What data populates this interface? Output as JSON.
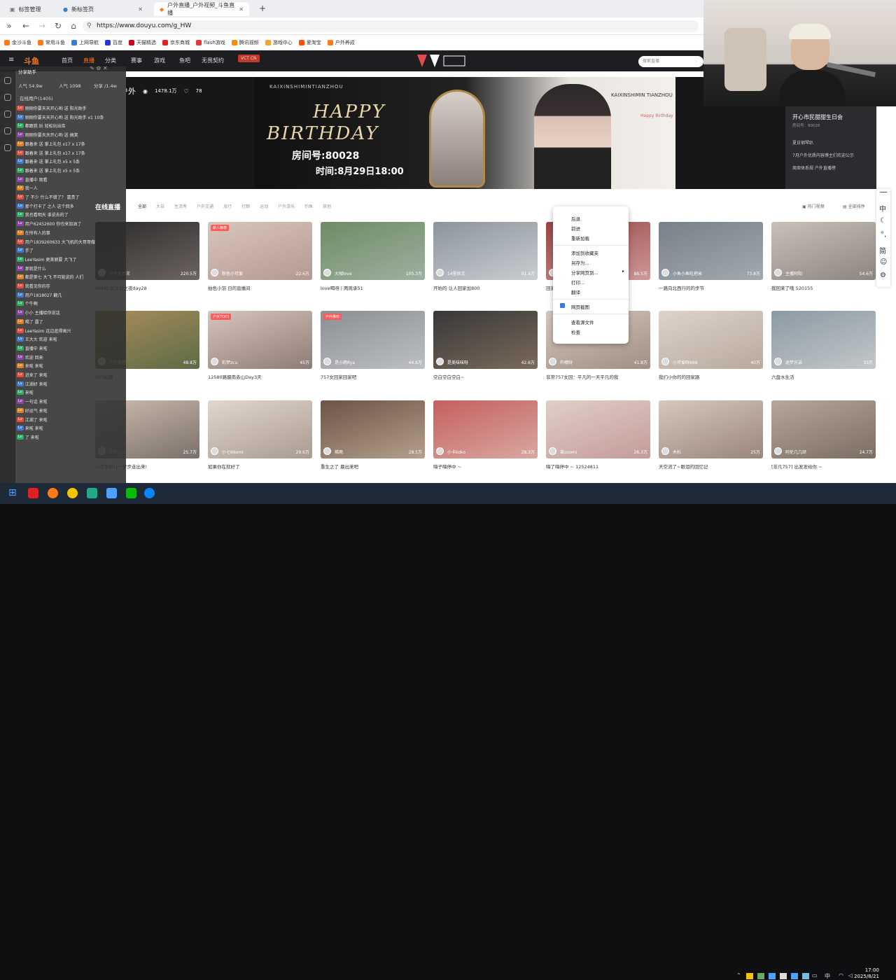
{
  "browser": {
    "tabs": [
      {
        "label": "标签管理"
      },
      {
        "label": "新标签页"
      },
      {
        "label": "户外直播_户外视频_斗鱼直播"
      }
    ],
    "url": "https://www.douyu.com/g_HW",
    "bookmarks": [
      "金沙斗鱼",
      "常用斗鱼",
      "上网导航",
      "百度",
      "天猫精选",
      "京东商城",
      "flash游戏",
      "腾讯视频",
      "游戏中心",
      "爱淘宝",
      "户外养成"
    ]
  },
  "site": {
    "logo": "斗鱼",
    "nav": [
      "首页",
      "直播",
      "分类",
      "赛事",
      "游戏",
      "鱼吧",
      "无畏契约"
    ],
    "vct_label": "VCT CN",
    "search_placeholder": "搜索直播"
  },
  "category": {
    "title": "户外",
    "views": "1478.1万",
    "followers": "78"
  },
  "left_panel": {
    "header": [
      "分享助手",
      "人气 54.9w",
      "人气 1098",
      "分享 /1.4w"
    ],
    "online_count": "在线用户(1405)",
    "live_now": "在线直播",
    "comments": [
      "刚刚你要天天开心哟 送 阳光助手",
      "刚刚你要天天开心哟 送 阳光助手 x1 10条",
      "都跟我 玩 轻松玩出库",
      "刚刚你要天天开心哟 送 搞笑",
      "跟着来 送 掌上礼包 x17 x 17条",
      "跟着来 送 掌上礼包 x17 x 17条",
      "跟着来 送 掌上礼包 x5 x 5条",
      "跟着来 送 掌上礼包 x5 x 5条",
      "直播中 观看",
      "我一人",
      "了 不少 什么不错了？ 富贵了",
      "那个打卡了 之人 这个回多",
      "我也看明天 谁说去的了",
      "用户62452600 你也来加油了",
      "在所有人的事",
      "用户1839260633 大飞机的大哥哥做",
      "手了",
      "LeeYasim 更美丽要 大飞了",
      "那就是什么",
      "都是第七 大飞 不可能说的 人们",
      "我看见你的存",
      "用户1818027 翻几",
      "个牛啊",
      "小小 主播给你说话",
      "喝了 露了",
      "LeeYasim 这边逛得高兴",
      "王大大 欢迎 来啦",
      "直播中 来啦",
      "欢迎 回来",
      "来啦 来啦",
      "进来了 来啦",
      "江湖好 来啦",
      "来啦",
      "一句话 来啦",
      "好运气 来啦",
      "江湖了 来啦",
      "来啦 来啦",
      "了 来啦"
    ]
  },
  "banner": {
    "kx_top": "KAIXINSHIMINTIANZHOU",
    "happy": "HAPPY",
    "birthday": "BIRTHDAY",
    "room": "房间号:80028",
    "time": "时间:8月29日18:00",
    "kx_right": "KAIXINSHIMIN TIANZHOU",
    "happy_small": "Happy Birthday",
    "right_title": "开心市民甜甜生日会",
    "right_sub": "房间号：80028",
    "right_items": [
      "夏日钢琴趴",
      "7月户外优质内容博主们欢迎公示",
      "周周体系规 户外直播榜"
    ]
  },
  "filters": {
    "tabs": [
      "全部",
      "大自",
      "生活秀",
      "户外交通",
      "旅行",
      "打野",
      "运动",
      "户外游乐",
      "钓鱼",
      "其他"
    ],
    "right": [
      "热门视频",
      "全部排序"
    ]
  },
  "cards": [
    {
      "name": "户外大师王",
      "views": "220.5万",
      "title": "988的 玩生日之夜day28",
      "tag": "",
      "c1": "#2b2b2b",
      "c2": "#6d6560"
    },
    {
      "name": "粉色小可爱",
      "views": "22.6万",
      "title": "拍色小羽 日的直播间",
      "tag": "新人推荐",
      "c1": "#d9c5bd",
      "c2": "#b39990"
    },
    {
      "name": "大咖love",
      "views": "105.3万",
      "title": "love喝呀 | 两周承51",
      "tag": "",
      "c1": "#6f8a64",
      "c2": "#9db1a0"
    },
    {
      "name": "14星辰文",
      "views": "91.4万",
      "title": "开始的 让人回家加800",
      "tag": "",
      "c1": "#8c949c",
      "c2": "#c8cdd0"
    },
    {
      "name": "户外行",
      "views": "86.5万",
      "title": "回家的路",
      "tag": "",
      "c1": "#9a4444",
      "c2": "#c99"
    },
    {
      "name": "小鱼小鱼吃把米",
      "views": "73.8万",
      "title": "一路向北西行的的步节",
      "tag": "",
      "c1": "#778088",
      "c2": "#a2aab0"
    },
    {
      "name": "主播阿阳",
      "views": "54.6万",
      "title": "我回来了哦 520155",
      "tag": "",
      "c1": "#c9c0b8",
      "c2": "#8c8580"
    },
    {
      "name": "户外侠客",
      "views": "48.8万",
      "title": "623拍摄",
      "tag": "",
      "c1": "#a98d5c",
      "c2": "#5d6b45"
    },
    {
      "name": "彩梦zcu",
      "views": "45万",
      "title": "12580路摄南赤山Day3天",
      "tag": "户外TOP3",
      "c1": "#d6c4be",
      "c2": "#8f7c74"
    },
    {
      "name": "是小雨Rya",
      "views": "44.6万",
      "title": "757女回家回家吧",
      "tag": "户外推荐",
      "c1": "#8b8f94",
      "c2": "#bcc0c4"
    },
    {
      "name": "是美味味呀",
      "views": "42.6万",
      "title": "空白空白空白~",
      "tag": "",
      "c1": "#383838",
      "c2": "#7a6a5a"
    },
    {
      "name": "柠檬呀",
      "views": "41.8万",
      "title": "非常757女回：平凡的一天平凡的我",
      "tag": "",
      "c1": "#d7c6bb",
      "c2": "#a09084"
    },
    {
      "name": "小可爱呀666",
      "views": "40万",
      "title": "我们小你的的回家路",
      "tag": "",
      "c1": "#dcd3cb",
      "c2": "#b9a99c"
    },
    {
      "name": "逐梦兄弟",
      "views": "33万",
      "title": "六盘水生活",
      "tag": "",
      "c1": "#8b9aa3",
      "c2": "#c3c7c9"
    },
    {
      "name": "户外小可",
      "views": "25.7万",
      "title": "小可爱好儿一步步走出来!",
      "tag": "",
      "c1": "#cdbcb0",
      "c2": "#7a7068"
    },
    {
      "name": "小七66omi",
      "views": "29.6万",
      "title": "如果你在就好了",
      "tag": "",
      "c1": "#e2d6cd",
      "c2": "#a99b90"
    },
    {
      "name": "稀雨",
      "views": "28.5万",
      "title": "重生之了 晨出来吧",
      "tag": "",
      "c1": "#6b5446",
      "c2": "#b59f8c"
    },
    {
      "name": "小卡koko",
      "views": "28.3万",
      "title": "嗨子嗨停中 ~",
      "tag": "",
      "c1": "#c46060",
      "c2": "#d9a7a0"
    },
    {
      "name": "曾ovomi",
      "views": "26.3万",
      "title": "嗨了嗨停中 ~ 12524811",
      "tag": "",
      "c1": "#e0cfc9",
      "c2": "#c49b98"
    },
    {
      "name": "木杉",
      "views": "25万",
      "title": "天空流了~眼泪的回忆记",
      "tag": "",
      "c1": "#d6c8bd",
      "c2": "#9a867a"
    },
    {
      "name": "阿伦几几研",
      "views": "24.7万",
      "title": "[非凡757] 出发发给你 ~",
      "tag": "",
      "c1": "#b6a79a",
      "c2": "#7c6d62"
    }
  ],
  "context_menu": {
    "items": [
      "后退",
      "前进",
      "重新加载",
      "添加到收藏夹",
      "另存为...",
      "分享网页到...",
      "打印...",
      "翻译",
      "网页截图",
      "查看源文件",
      "检查"
    ]
  },
  "right_toolbar": [
    "中",
    "简"
  ],
  "taskbar": {
    "time": "17:00",
    "date": "2025/8/21",
    "ime": "中"
  }
}
